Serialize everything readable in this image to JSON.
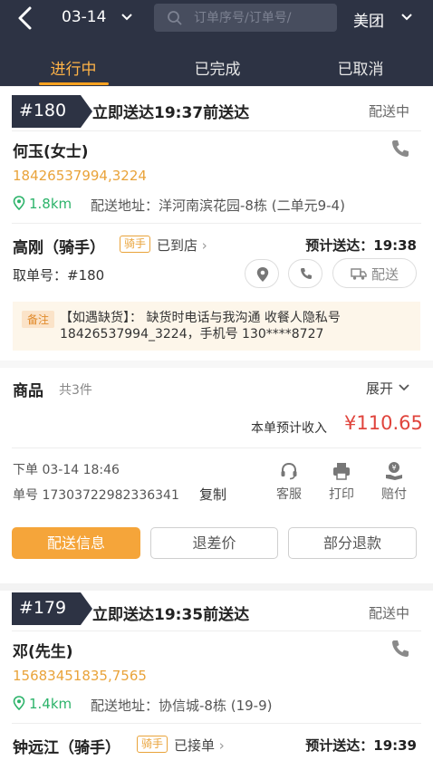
{
  "header": {
    "date": "03-14",
    "search_placeholder": "订单序号/订单号/",
    "platform": "美团",
    "tabs": [
      "进行中",
      "已完成",
      "已取消"
    ]
  },
  "orders": [
    {
      "seq": "#180",
      "title": "立即送达19:37前送达",
      "status": "配送中",
      "customer": "何玉(女士)",
      "phone": "18426537994,3224",
      "distance": "1.8km",
      "address": "配送地址：洋河南滨花园-8栋 (二单元9-4)",
      "rider": "高刚（骑手）",
      "rider_tag": "骑手",
      "rider_status": "已到店",
      "eta": "预计送达：19:38",
      "pickup": "取单号：#180",
      "dispatch": "配送",
      "note_tag": "备注",
      "note": "【如遇缺货】： 缺货时电话与我沟通 收餐人隐私号 18426537994_3224，手机号 130****8727",
      "goods_label": "商品",
      "goods_count": "共3件",
      "expand": "展开",
      "income_label": "本单预计收入",
      "income": "¥110.65",
      "order_time": "下单 03-14 18:46",
      "order_no": "单号 17303722982336341",
      "copy": "复制",
      "actions": [
        "客服",
        "打印",
        "赔付"
      ],
      "buttons": [
        "配送信息",
        "退差价",
        "部分退款"
      ]
    },
    {
      "seq": "#179",
      "title": "立即送达19:35前送达",
      "status": "配送中",
      "customer": "邓(先生)",
      "phone": "15683451835,7565",
      "distance": "1.4km",
      "address": "配送地址：协信城-8栋 (19-9)",
      "rider": "钟远江（骑手）",
      "rider_tag": "骑手",
      "rider_status": "已接单",
      "eta": "预计送达：19:39"
    }
  ],
  "colors": {
    "header_bg": "#2d3344",
    "accent": "#f5a53a",
    "price": "#e0443c",
    "phone": "#e9a33a",
    "distance": "#2cb36a"
  }
}
